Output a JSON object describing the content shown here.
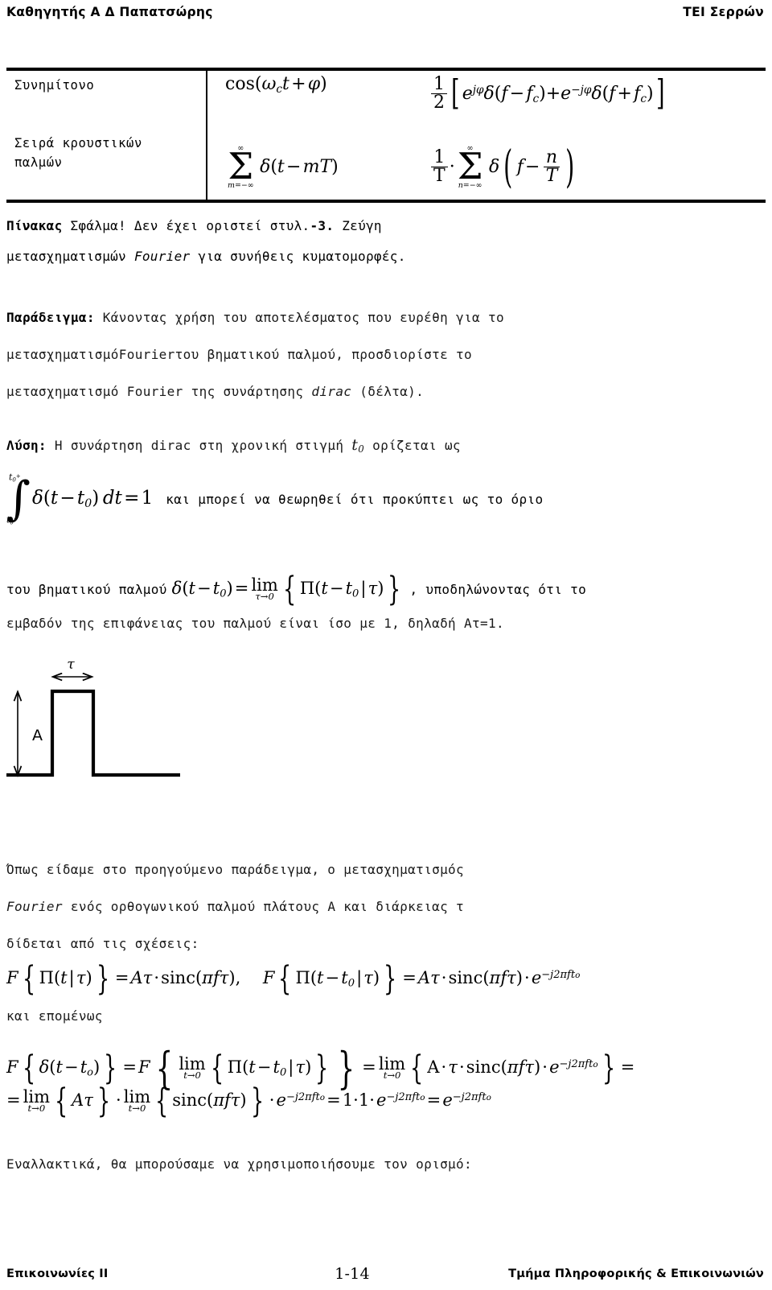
{
  "header": {
    "left": "Καθηγητής Α Δ Παπατσώρης",
    "right": "ΤΕΙ Σερρών"
  },
  "table": {
    "rows": [
      {
        "name": "Συνημίτονο",
        "time_formula": "cos(ω_c t + φ)",
        "freq_formula": "(1/2)[ e^{jφ} δ(f − f_c) + e^{−jφ} δ(f + f_c) ]"
      },
      {
        "name": "Σειρά κρουστικών παλμών",
        "name_line1": "Σειρά κρουστικών",
        "name_line2": "παλμών",
        "time_formula": "Σ_{m=−∞}^{∞} δ(t − mT)",
        "freq_formula": "(1/T) · Σ_{n=−∞}^{∞} δ(f − n/T)"
      }
    ]
  },
  "caption": {
    "label": "Πίνακας",
    "error_text": " Σφάλμα! Δεν έχει οριστεί στυλ.",
    "number": "-3.",
    "rest_line1": " Ζεύγη",
    "line2_a": "μετασχηματισμών ",
    "line2_italic": "Fourier",
    "line2_b": " για συνήθεις κυματομορφές."
  },
  "example": {
    "label": "Παράδειγμα:",
    "line1": " Κάνοντας χρήση του αποτελέσματος που ευρέθη για το",
    "line2_a": "μετασχηματισμό ",
    "line2_lat": "Fourier",
    "line2_b": " του βηματικού παλμού, προσδιορίστε το",
    "line3_a": "μετασχηματισμό ",
    "line3_lat": "Fourier",
    "line3_b": " της συνάρτησης ",
    "line3_italic": "dirac",
    "line3_c": " (δέλτα)."
  },
  "solution": {
    "label": "Λύση:",
    "line1_a": " Η συνάρτηση ",
    "line1_lat": "dirac",
    "line1_b": " στη χρονική στιγμή ",
    "line1_math": "t₀",
    "line1_c": " ορίζεται ως",
    "integral": "∫_{t₀⁻}^{t₀⁺} δ(t − t₀) dt = 1",
    "line2": "και μπορεί να θεωρηθεί ότι προκύπτει ως το όριο",
    "line3_a": "του βηματικού παλμού ",
    "line3_math": "δ(t − t₀) = lim_{τ→0} { Π(t − t₀ | τ) }",
    "line3_b": ", υποδηλώνοντας ότι το",
    "line4": "εμβαδόν της επιφάνειας του παλμού είναι ίσο με 1, δηλαδή Ατ=1."
  },
  "figure": {
    "amplitude_label": "A",
    "width_label": "τ",
    "description": "rectangular pulse of amplitude A and duration tau"
  },
  "recap": {
    "line1": "Όπως είδαμε στο προηγούμενο παράδειγμα, ο μετασχηματισμός",
    "line2_lat": "Fourier",
    "line2_b": " ενός ορθογωνικού παλμού πλάτους Α και διάρκειας τ",
    "line3": "δίδεται από τις σχέσεις:"
  },
  "equations": {
    "eq1_left": "F{Π(t|τ)} = Aτ · sinc(πfτ),",
    "eq1_right": "F{Π(t − t₀|τ)} = Aτ · sinc(πfτ) · e^{−j2πft_o}",
    "and_therefore": "και επομένως",
    "eq2_line1": "F{δ(t − t_o)} = F{ lim_{t→0} { Π(t − t₀ | τ) } } = lim_{t→0} { A · τ · sinc(πfτ) · e^{−j2πft_o} } =",
    "eq2_line2": "= lim_{t→0}{Aτ} · lim_{t→0}{sinc(πfτ)} · e^{−j2πft_o} = 1·1· e^{−j2πft_o} = e^{−j2πft_o}"
  },
  "closing": {
    "line": "Εναλλακτικά, θα μπορούσαμε να χρησιμοποιήσουμε τον ορισμό:"
  },
  "footer": {
    "left": "Επικοινωνίες ΙΙ",
    "center": "1-14",
    "right": "Τμήμα Πληροφορικής & Επικοινωνιών"
  }
}
